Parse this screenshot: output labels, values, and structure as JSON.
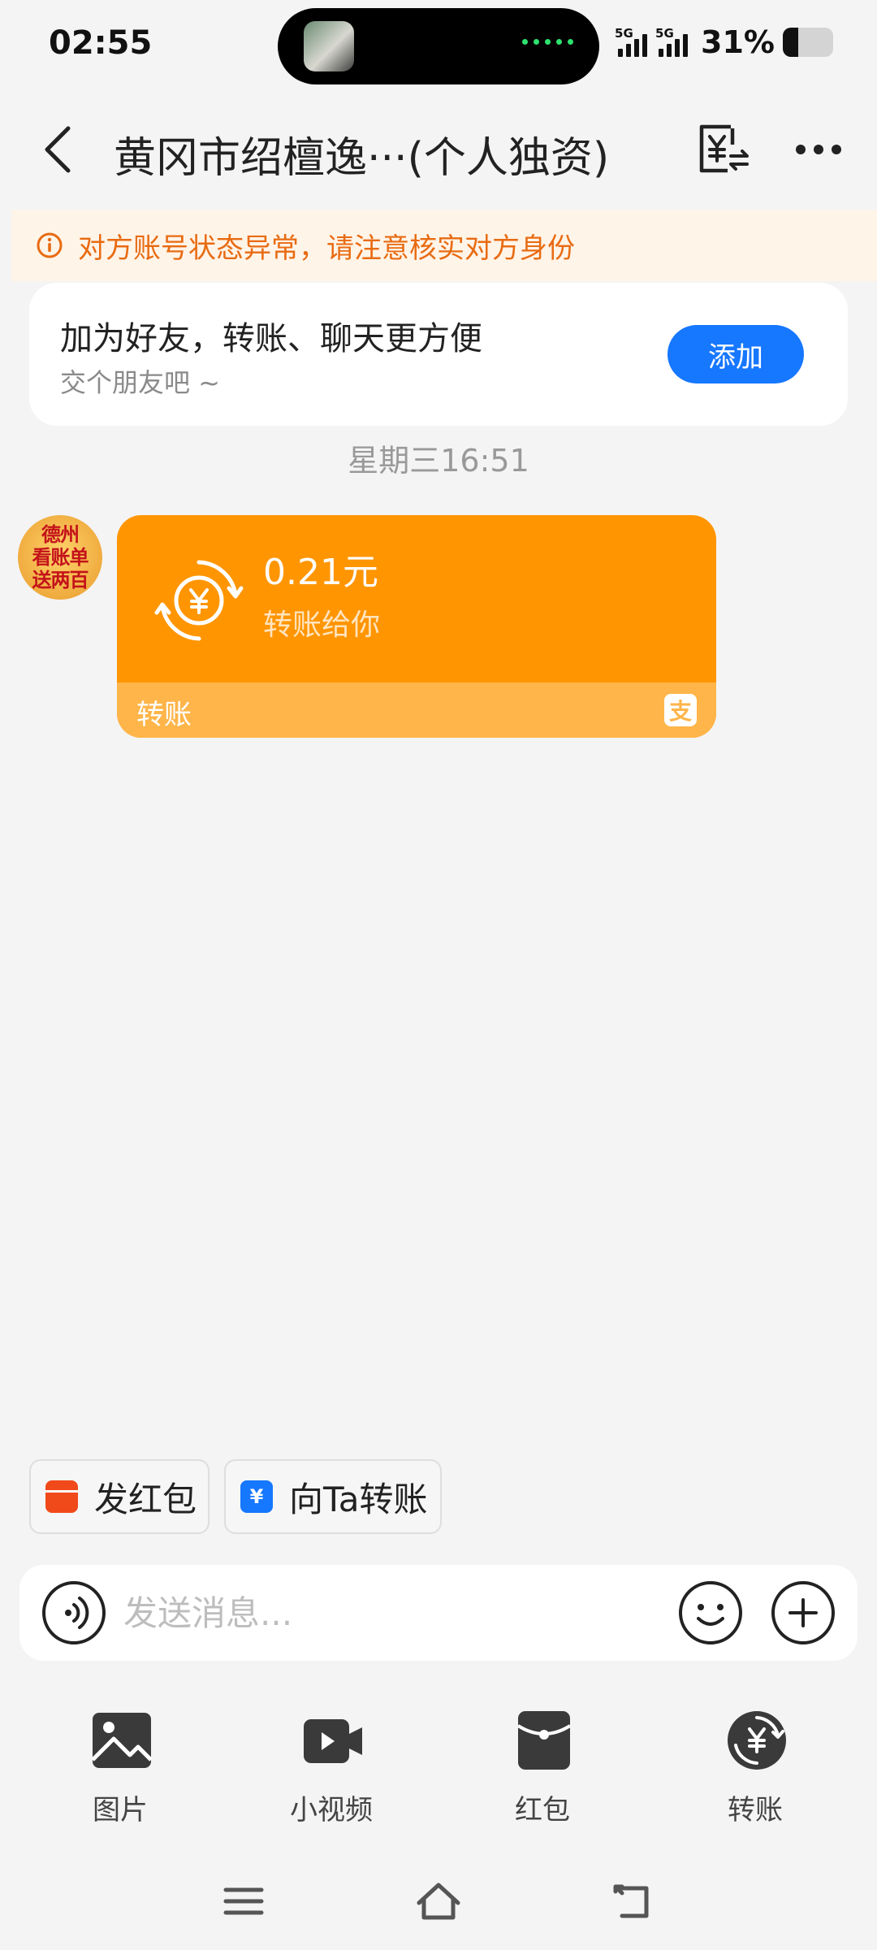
{
  "status_bar": {
    "time": "02:55",
    "network_1": "5G",
    "network_2": "5G",
    "battery_text": "31%",
    "battery_level": 0.31
  },
  "nav": {
    "title": "黄冈市绍檀逸···(个人独资)",
    "back_icon": "chevron-left-icon",
    "bill_icon": "yuan-bill-icon",
    "more_icon": "more-dots-icon"
  },
  "warning": {
    "icon": "info-circle-icon",
    "text": "对方账号状态异常，请注意核实对方身份"
  },
  "friend_card": {
    "title": "加为好友，转账、聊天更方便",
    "subtitle": "交个朋友吧 ~",
    "add_label": "添加"
  },
  "chat": {
    "timestamp": "星期三16:51",
    "avatar_text": [
      "德州",
      "看账单",
      "送两百"
    ],
    "transfer": {
      "amount": "0.21元",
      "description": "转账给你",
      "footer_label": "转账",
      "footer_icon": "支"
    }
  },
  "quick_actions": {
    "red_packet": "发红包",
    "transfer": "向Ta转账"
  },
  "input": {
    "placeholder": "发送消息..."
  },
  "tools": [
    {
      "label": "图片",
      "icon": "image-icon"
    },
    {
      "label": "小视频",
      "icon": "video-icon"
    },
    {
      "label": "红包",
      "icon": "red-packet-icon"
    },
    {
      "label": "转账",
      "icon": "transfer-icon"
    }
  ],
  "colors": {
    "brand_blue": "#1677ff",
    "transfer_orange": "#ff9500",
    "warning_orange": "#e86b12"
  }
}
